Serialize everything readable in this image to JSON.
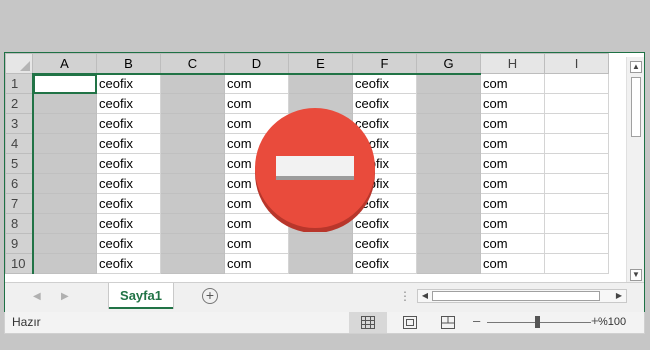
{
  "columns": [
    "A",
    "B",
    "C",
    "D",
    "E",
    "F",
    "G",
    "H",
    "I"
  ],
  "rows": [
    {
      "n": "1",
      "b": "ceofix",
      "d": "com",
      "f": "ceofix",
      "h": "com"
    },
    {
      "n": "2",
      "b": "ceofix",
      "d": "com",
      "f": "ceofix",
      "h": "com"
    },
    {
      "n": "3",
      "b": "ceofix",
      "d": "com",
      "f": "ceofix",
      "h": "com"
    },
    {
      "n": "4",
      "b": "ceofix",
      "d": "com",
      "f": "ceofix",
      "h": "com"
    },
    {
      "n": "5",
      "b": "ceofix",
      "d": "com",
      "f": "ceofix",
      "h": "com"
    },
    {
      "n": "6",
      "b": "ceofix",
      "d": "com",
      "f": "ceofix",
      "h": "com"
    },
    {
      "n": "7",
      "b": "ceofix",
      "d": "com",
      "f": "ceofix",
      "h": "com"
    },
    {
      "n": "8",
      "b": "ceofix",
      "d": "com",
      "f": "ceofix",
      "h": "com"
    },
    {
      "n": "9",
      "b": "ceofix",
      "d": "com",
      "f": "ceofix",
      "h": "com"
    },
    {
      "n": "10",
      "b": "ceofix",
      "d": "com",
      "f": "ceofix",
      "h": "com"
    }
  ],
  "sheet_tab": "Sayfa1",
  "add_sheet_icon": "+",
  "status": "Hazır",
  "zoom": {
    "minus": "–",
    "plus": "+",
    "level": "%100"
  },
  "overlay_icon": "minus-circle-icon",
  "colors": {
    "accent": "#217346",
    "hidden_column": "#c8c8c8",
    "overlay_red": "#e94b3c"
  }
}
